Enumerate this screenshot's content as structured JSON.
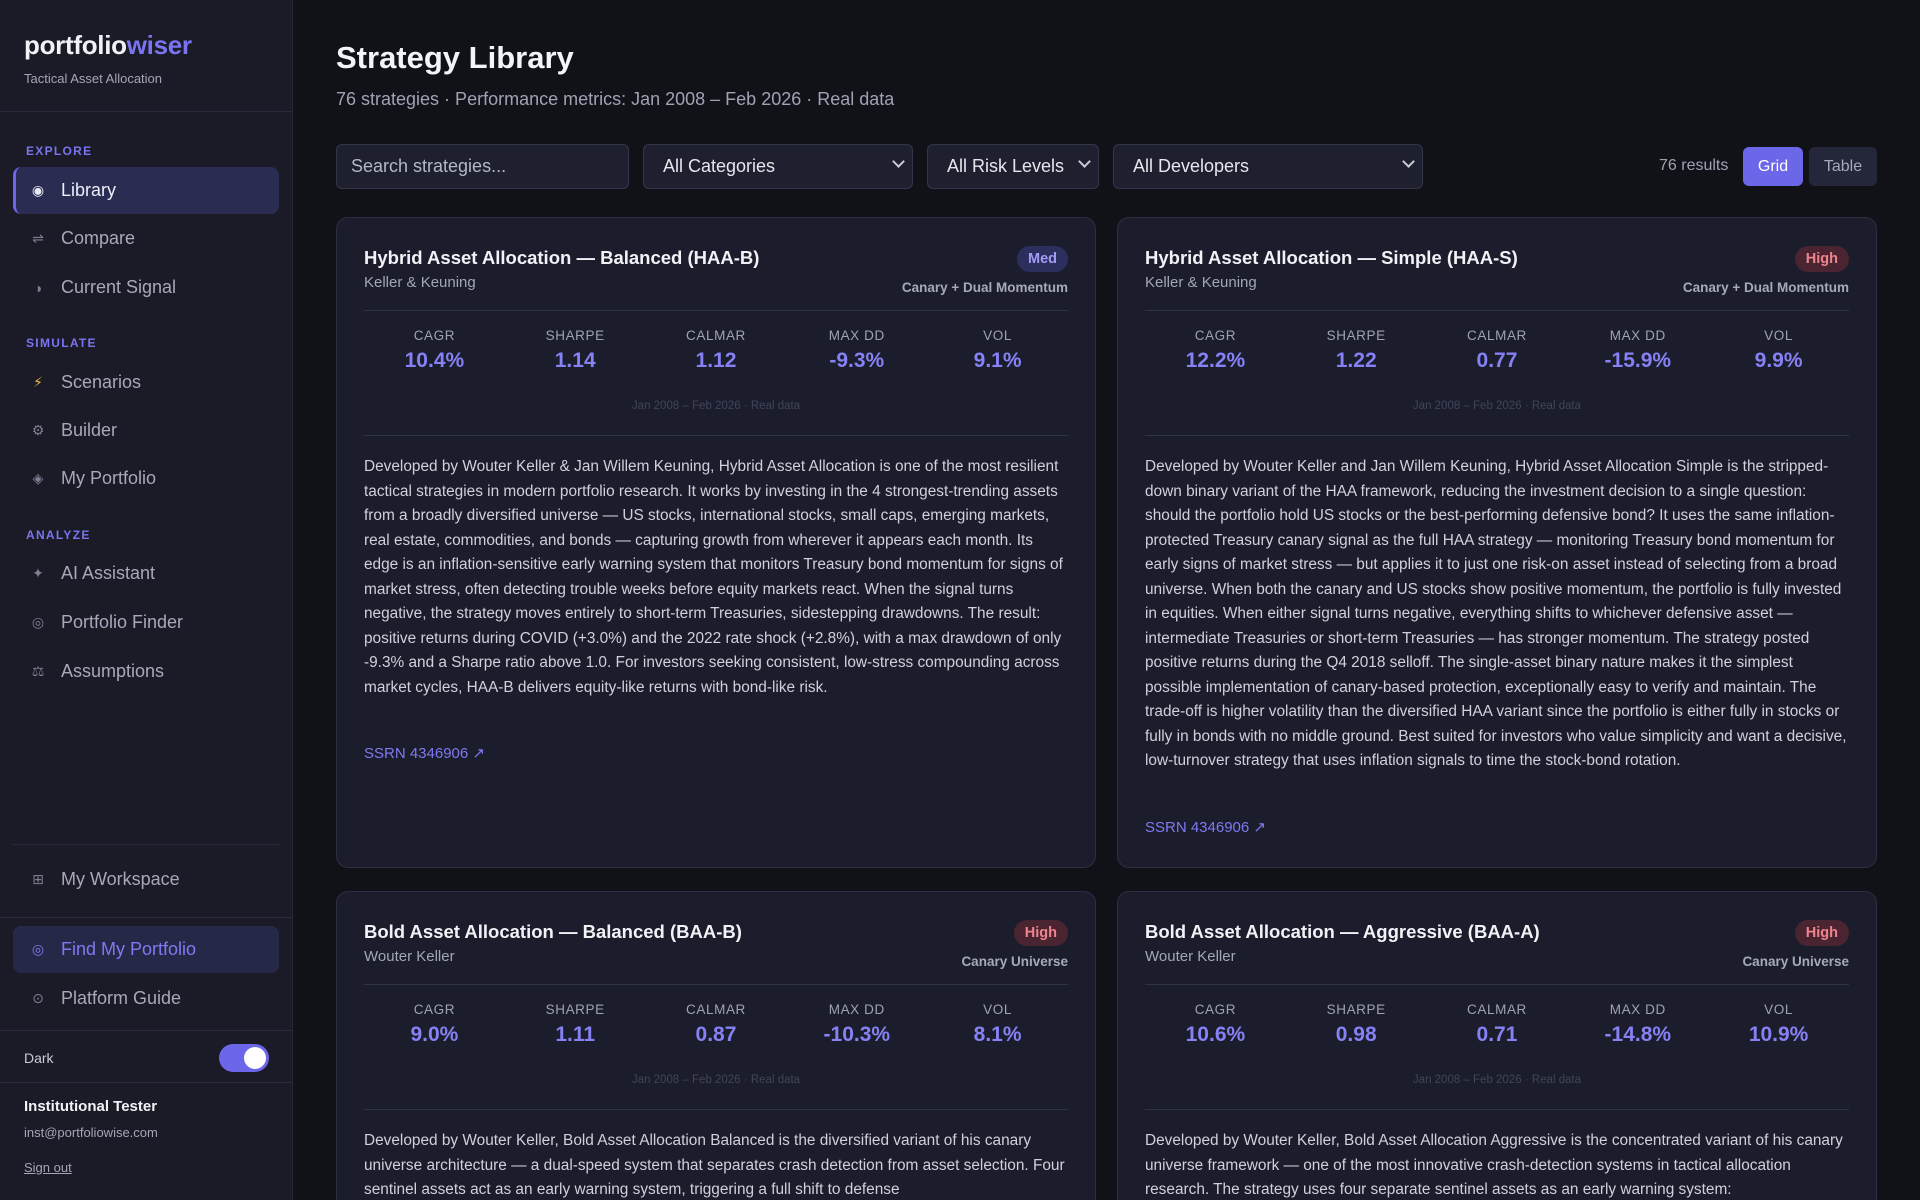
{
  "brand": {
    "name_part1": "portfolio",
    "name_part2": "wiser",
    "tagline": "Tactical Asset Allocation"
  },
  "sidebar": {
    "sections": {
      "explore": "EXPLORE",
      "simulate": "SIMULATE",
      "analyze": "ANALYZE"
    },
    "items": [
      {
        "label": "Library",
        "icon": "library-icon"
      },
      {
        "label": "Compare",
        "icon": "compare-icon"
      },
      {
        "label": "Current Signal",
        "icon": "signal-icon"
      },
      {
        "label": "Scenarios",
        "icon": "lightning-icon"
      },
      {
        "label": "Builder",
        "icon": "builder-icon"
      },
      {
        "label": "My Portfolio",
        "icon": "portfolio-icon"
      },
      {
        "label": "AI Assistant",
        "icon": "sparkle-icon"
      },
      {
        "label": "Portfolio Finder",
        "icon": "finder-icon"
      },
      {
        "label": "Assumptions",
        "icon": "scale-icon"
      }
    ],
    "workspace": "My Workspace",
    "find": "Find My Portfolio",
    "guide": "Platform Guide",
    "dark_label": "Dark",
    "dark_enabled": true,
    "user": {
      "name": "Institutional Tester",
      "email": "inst@portfoliowise.com",
      "signout": "Sign out"
    }
  },
  "header": {
    "title": "Strategy Library",
    "subtitle": "76 strategies · Performance metrics: Jan 2008 – Feb 2026 · Real data"
  },
  "filters": {
    "search_placeholder": "Search strategies...",
    "category": "All Categories",
    "risk": "All Risk Levels",
    "developer": "All Developers",
    "results": "76 results",
    "grid": "Grid",
    "table": "Table"
  },
  "metric_labels": {
    "cagr": "CAGR",
    "sharpe": "SHARPE",
    "calmar": "CALMAR",
    "maxdd": "MAX DD",
    "vol": "VOL"
  },
  "cards": [
    {
      "title": "Hybrid Asset Allocation — Balanced (HAA-B)",
      "developer": "Keller & Keuning",
      "risk": "Med",
      "category": "Canary + Dual Momentum",
      "cagr": "10.4%",
      "sharpe": "1.14",
      "calmar": "1.12",
      "maxdd": "-9.3%",
      "vol": "9.1%",
      "period": "Jan 2008 – Feb 2026 · Real data",
      "description": "Developed by Wouter Keller & Jan Willem Keuning, Hybrid Asset Allocation is one of the most resilient tactical strategies in modern portfolio research. It works by investing in the 4 strongest-trending assets from a broadly diversified universe — US stocks, international stocks, small caps, emerging markets, real estate, commodities, and bonds — capturing growth from wherever it appears each month. Its edge is an inflation-sensitive early warning system that monitors Treasury bond momentum for signs of market stress, often detecting trouble weeks before equity markets react. When the signal turns negative, the strategy moves entirely to short-term Treasuries, sidestepping drawdowns. The result: positive returns during COVID (+3.0%) and the 2022 rate shock (+2.8%), with a max drawdown of only -9.3% and a Sharpe ratio above 1.0. For investors seeking consistent, low-stress compounding across market cycles, HAA-B delivers equity-like returns with bond-like risk.",
      "link": "SSRN 4346906 ↗"
    },
    {
      "title": "Hybrid Asset Allocation — Simple (HAA-S)",
      "developer": "Keller & Keuning",
      "risk": "High",
      "category": "Canary + Dual Momentum",
      "cagr": "12.2%",
      "sharpe": "1.22",
      "calmar": "0.77",
      "maxdd": "-15.9%",
      "vol": "9.9%",
      "period": "Jan 2008 – Feb 2026 · Real data",
      "description": "Developed by Wouter Keller and Jan Willem Keuning, Hybrid Asset Allocation Simple is the stripped-down binary variant of the HAA framework, reducing the investment decision to a single question: should the portfolio hold US stocks or the best-performing defensive bond? It uses the same inflation-protected Treasury canary signal as the full HAA strategy — monitoring Treasury bond momentum for early signs of market stress — but applies it to just one risk-on asset instead of selecting from a broad universe. When both the canary and US stocks show positive momentum, the portfolio is fully invested in equities. When either signal turns negative, everything shifts to whichever defensive asset — intermediate Treasuries or short-term Treasuries — has stronger momentum. The strategy posted positive returns during the Q4 2018 selloff. The single-asset binary nature makes it the simplest possible implementation of canary-based protection, exceptionally easy to verify and maintain. The trade-off is higher volatility than the diversified HAA variant since the portfolio is either fully in stocks or fully in bonds with no middle ground. Best suited for investors who value simplicity and want a decisive, low-turnover strategy that uses inflation signals to time the stock-bond rotation.",
      "link": "SSRN 4346906 ↗"
    },
    {
      "title": "Bold Asset Allocation — Balanced (BAA-B)",
      "developer": "Wouter Keller",
      "risk": "High",
      "category": "Canary Universe",
      "cagr": "9.0%",
      "sharpe": "1.11",
      "calmar": "0.87",
      "maxdd": "-10.3%",
      "vol": "8.1%",
      "period": "Jan 2008 – Feb 2026 · Real data",
      "description": "Developed by Wouter Keller, Bold Asset Allocation Balanced is the diversified variant of his canary universe architecture — a dual-speed system that separates crash detection from asset selection. Four sentinel assets act as an early warning system, triggering a full shift to defense",
      "link": ""
    },
    {
      "title": "Bold Asset Allocation — Aggressive (BAA-A)",
      "developer": "Wouter Keller",
      "risk": "High",
      "category": "Canary Universe",
      "cagr": "10.6%",
      "sharpe": "0.98",
      "calmar": "0.71",
      "maxdd": "-14.8%",
      "vol": "10.9%",
      "period": "Jan 2008 – Feb 2026 · Real data",
      "description": "Developed by Wouter Keller, Bold Asset Allocation Aggressive is the concentrated variant of his canary universe framework — one of the most innovative crash-detection systems in tactical allocation research. The strategy uses four separate sentinel assets as an early warning system:",
      "link": ""
    }
  ]
}
